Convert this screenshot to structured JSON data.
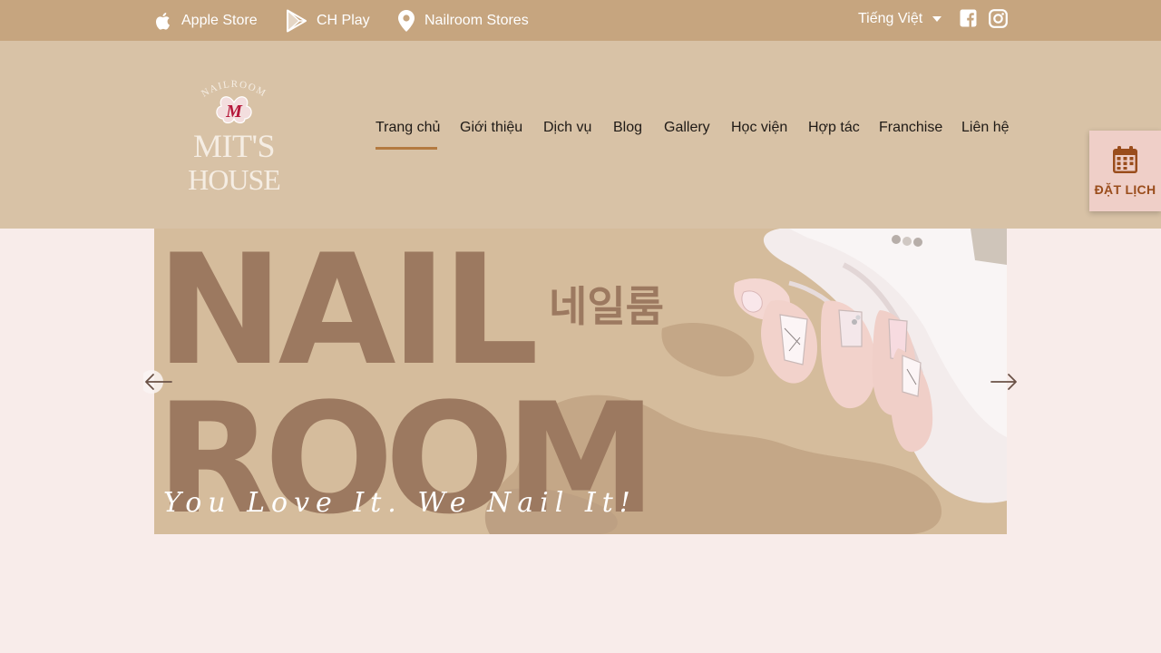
{
  "topbar": {
    "links": [
      {
        "label": "Apple Store",
        "icon": "apple-icon"
      },
      {
        "label": "CH Play",
        "icon": "google-play-icon"
      },
      {
        "label": "Nailroom Stores",
        "icon": "map-pin-icon"
      }
    ],
    "language": "Tiếng Việt",
    "social": [
      "facebook-icon",
      "instagram-icon"
    ]
  },
  "logo": {
    "top_text": "NAILROOM",
    "monogram": "M",
    "line1": "MIT'S",
    "line2": "HOUSE"
  },
  "nav": {
    "items": [
      "Trang chủ",
      "Giới thiệu",
      "Dịch vụ",
      "Blog",
      "Gallery",
      "Học viện",
      "Hợp tác",
      "Franchise",
      "Liên hệ"
    ],
    "active": "Trang chủ"
  },
  "booking": {
    "label": "ĐẶT LỊCH",
    "icon": "calendar-icon"
  },
  "banner": {
    "line1": "NAIL",
    "line2": "ROOM",
    "korean": "네일룸",
    "tagline": "You Love It. We Nail It!"
  },
  "colors": {
    "topbar": "#c6a57f",
    "header": "#d8c2a6",
    "page": "#f8ecea",
    "accent": "#b47a40",
    "banner_text": "#9c7960"
  }
}
